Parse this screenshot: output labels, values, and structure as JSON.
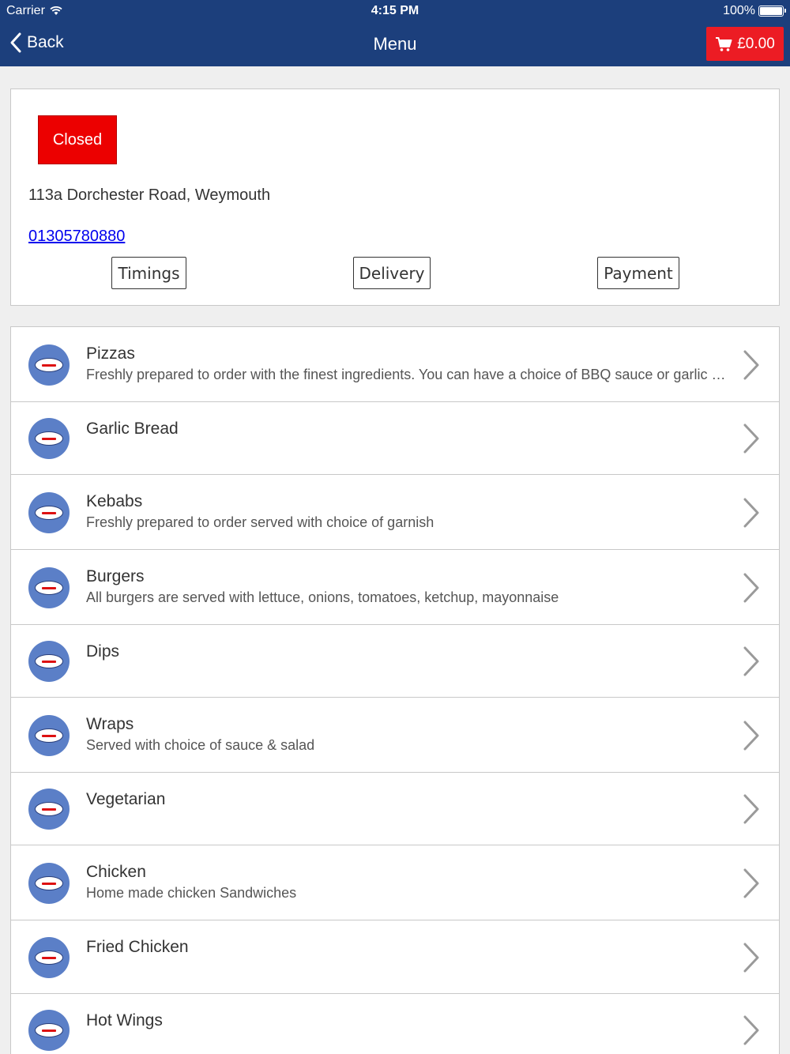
{
  "status_bar": {
    "carrier": "Carrier",
    "time": "4:15 PM",
    "battery": "100%"
  },
  "nav": {
    "back_label": "Back",
    "title": "Menu",
    "cart_total": "£0.00"
  },
  "store": {
    "status": "Closed",
    "address": "113a Dorchester Road, Weymouth",
    "phone": "01305780880",
    "buttons": {
      "timings": "Timings",
      "delivery": "Delivery",
      "payment": "Payment"
    }
  },
  "colors": {
    "nav_blue": "#1c3f7c",
    "cart_red": "#ec1c24",
    "closed_red": "#ec0000",
    "logo_blue": "#5b7fc7"
  },
  "menu_items": [
    {
      "name": "Pizzas",
      "description": "Freshly prepared to order with the finest ingredients. You can have a choice of BBQ sauce or garlic sauce"
    },
    {
      "name": "Garlic Bread",
      "description": ""
    },
    {
      "name": "Kebabs",
      "description": "Freshly prepared to order served with choice of garnish"
    },
    {
      "name": "Burgers",
      "description": "All burgers are served with lettuce, onions, tomatoes, ketchup, mayonnaise"
    },
    {
      "name": "Dips",
      "description": ""
    },
    {
      "name": "Wraps",
      "description": "Served with choice of sauce & salad"
    },
    {
      "name": "Vegetarian",
      "description": ""
    },
    {
      "name": "Chicken",
      "description": "Home  made chicken Sandwiches"
    },
    {
      "name": "Fried Chicken",
      "description": ""
    },
    {
      "name": "Hot Wings",
      "description": ""
    }
  ]
}
